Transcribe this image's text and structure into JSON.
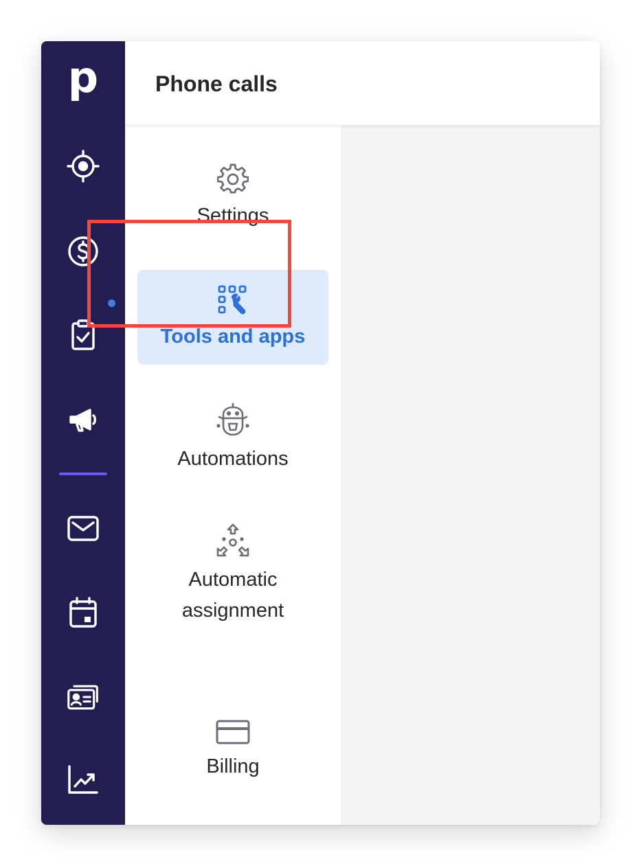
{
  "app": {
    "logo_letter": "p",
    "page_title": "Phone calls"
  },
  "rail": {
    "items": [
      {
        "name": "leads",
        "icon": "target-icon"
      },
      {
        "name": "deals",
        "icon": "dollar-circle-icon"
      },
      {
        "name": "activities",
        "icon": "clipboard-check-icon",
        "has_notification_dot": true
      },
      {
        "name": "campaigns",
        "icon": "megaphone-icon"
      },
      {
        "name": "mail",
        "icon": "envelope-icon"
      },
      {
        "name": "calendar",
        "icon": "calendar-icon"
      },
      {
        "name": "contacts",
        "icon": "contact-cards-icon"
      },
      {
        "name": "insights",
        "icon": "chart-trend-icon"
      }
    ],
    "background": "#221e51",
    "notification_dot_color": "#3a7ee8",
    "divider_color": "#6a56e8"
  },
  "subnav": {
    "items": [
      {
        "label": "Settings",
        "icon": "gear-icon",
        "active": false
      },
      {
        "label": "Tools and apps",
        "icon": "tools-apps-icon",
        "active": true
      },
      {
        "label": "Automations",
        "icon": "robot-icon",
        "active": false
      },
      {
        "label_line1": "Automatic",
        "label_line2": "assignment",
        "icon": "assignment-arrows-icon",
        "active": false
      },
      {
        "label": "Billing",
        "icon": "credit-card-icon",
        "active": false
      }
    ],
    "active_bg": "#deebfd",
    "active_text_color": "#2d70d6",
    "highlight_border_color": "#f2493a"
  }
}
